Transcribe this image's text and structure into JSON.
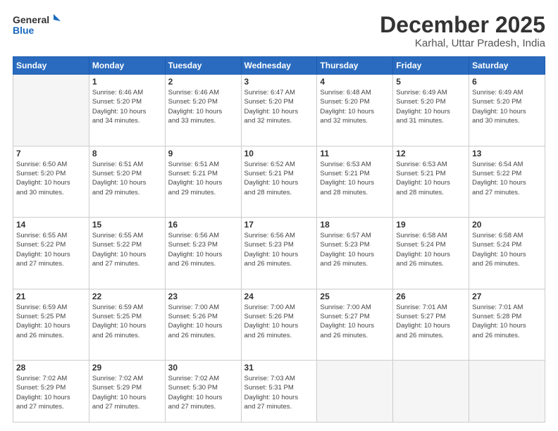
{
  "logo": {
    "line1": "General",
    "line2": "Blue"
  },
  "header": {
    "month": "December 2025",
    "location": "Karhal, Uttar Pradesh, India"
  },
  "weekdays": [
    "Sunday",
    "Monday",
    "Tuesday",
    "Wednesday",
    "Thursday",
    "Friday",
    "Saturday"
  ],
  "weeks": [
    [
      {
        "day": "",
        "info": ""
      },
      {
        "day": "1",
        "info": "Sunrise: 6:46 AM\nSunset: 5:20 PM\nDaylight: 10 hours\nand 34 minutes."
      },
      {
        "day": "2",
        "info": "Sunrise: 6:46 AM\nSunset: 5:20 PM\nDaylight: 10 hours\nand 33 minutes."
      },
      {
        "day": "3",
        "info": "Sunrise: 6:47 AM\nSunset: 5:20 PM\nDaylight: 10 hours\nand 32 minutes."
      },
      {
        "day": "4",
        "info": "Sunrise: 6:48 AM\nSunset: 5:20 PM\nDaylight: 10 hours\nand 32 minutes."
      },
      {
        "day": "5",
        "info": "Sunrise: 6:49 AM\nSunset: 5:20 PM\nDaylight: 10 hours\nand 31 minutes."
      },
      {
        "day": "6",
        "info": "Sunrise: 6:49 AM\nSunset: 5:20 PM\nDaylight: 10 hours\nand 30 minutes."
      }
    ],
    [
      {
        "day": "7",
        "info": "Sunrise: 6:50 AM\nSunset: 5:20 PM\nDaylight: 10 hours\nand 30 minutes."
      },
      {
        "day": "8",
        "info": "Sunrise: 6:51 AM\nSunset: 5:20 PM\nDaylight: 10 hours\nand 29 minutes."
      },
      {
        "day": "9",
        "info": "Sunrise: 6:51 AM\nSunset: 5:21 PM\nDaylight: 10 hours\nand 29 minutes."
      },
      {
        "day": "10",
        "info": "Sunrise: 6:52 AM\nSunset: 5:21 PM\nDaylight: 10 hours\nand 28 minutes."
      },
      {
        "day": "11",
        "info": "Sunrise: 6:53 AM\nSunset: 5:21 PM\nDaylight: 10 hours\nand 28 minutes."
      },
      {
        "day": "12",
        "info": "Sunrise: 6:53 AM\nSunset: 5:21 PM\nDaylight: 10 hours\nand 28 minutes."
      },
      {
        "day": "13",
        "info": "Sunrise: 6:54 AM\nSunset: 5:22 PM\nDaylight: 10 hours\nand 27 minutes."
      }
    ],
    [
      {
        "day": "14",
        "info": "Sunrise: 6:55 AM\nSunset: 5:22 PM\nDaylight: 10 hours\nand 27 minutes."
      },
      {
        "day": "15",
        "info": "Sunrise: 6:55 AM\nSunset: 5:22 PM\nDaylight: 10 hours\nand 27 minutes."
      },
      {
        "day": "16",
        "info": "Sunrise: 6:56 AM\nSunset: 5:23 PM\nDaylight: 10 hours\nand 26 minutes."
      },
      {
        "day": "17",
        "info": "Sunrise: 6:56 AM\nSunset: 5:23 PM\nDaylight: 10 hours\nand 26 minutes."
      },
      {
        "day": "18",
        "info": "Sunrise: 6:57 AM\nSunset: 5:23 PM\nDaylight: 10 hours\nand 26 minutes."
      },
      {
        "day": "19",
        "info": "Sunrise: 6:58 AM\nSunset: 5:24 PM\nDaylight: 10 hours\nand 26 minutes."
      },
      {
        "day": "20",
        "info": "Sunrise: 6:58 AM\nSunset: 5:24 PM\nDaylight: 10 hours\nand 26 minutes."
      }
    ],
    [
      {
        "day": "21",
        "info": "Sunrise: 6:59 AM\nSunset: 5:25 PM\nDaylight: 10 hours\nand 26 minutes."
      },
      {
        "day": "22",
        "info": "Sunrise: 6:59 AM\nSunset: 5:25 PM\nDaylight: 10 hours\nand 26 minutes."
      },
      {
        "day": "23",
        "info": "Sunrise: 7:00 AM\nSunset: 5:26 PM\nDaylight: 10 hours\nand 26 minutes."
      },
      {
        "day": "24",
        "info": "Sunrise: 7:00 AM\nSunset: 5:26 PM\nDaylight: 10 hours\nand 26 minutes."
      },
      {
        "day": "25",
        "info": "Sunrise: 7:00 AM\nSunset: 5:27 PM\nDaylight: 10 hours\nand 26 minutes."
      },
      {
        "day": "26",
        "info": "Sunrise: 7:01 AM\nSunset: 5:27 PM\nDaylight: 10 hours\nand 26 minutes."
      },
      {
        "day": "27",
        "info": "Sunrise: 7:01 AM\nSunset: 5:28 PM\nDaylight: 10 hours\nand 26 minutes."
      }
    ],
    [
      {
        "day": "28",
        "info": "Sunrise: 7:02 AM\nSunset: 5:29 PM\nDaylight: 10 hours\nand 27 minutes."
      },
      {
        "day": "29",
        "info": "Sunrise: 7:02 AM\nSunset: 5:29 PM\nDaylight: 10 hours\nand 27 minutes."
      },
      {
        "day": "30",
        "info": "Sunrise: 7:02 AM\nSunset: 5:30 PM\nDaylight: 10 hours\nand 27 minutes."
      },
      {
        "day": "31",
        "info": "Sunrise: 7:03 AM\nSunset: 5:31 PM\nDaylight: 10 hours\nand 27 minutes."
      },
      {
        "day": "",
        "info": ""
      },
      {
        "day": "",
        "info": ""
      },
      {
        "day": "",
        "info": ""
      }
    ]
  ]
}
